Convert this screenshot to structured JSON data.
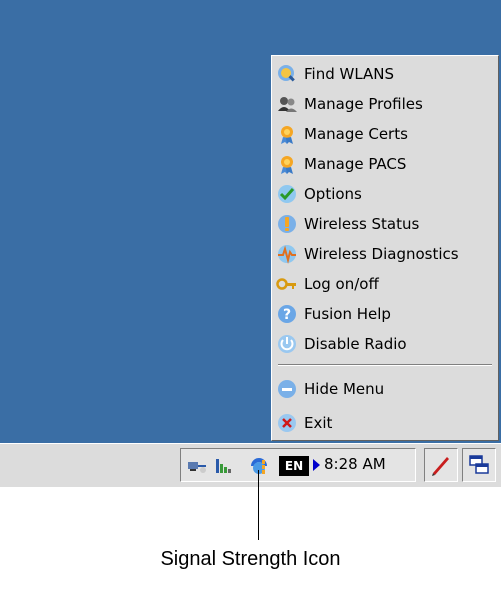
{
  "menu": {
    "items": [
      {
        "label": "Find WLANS",
        "icon": "find-wlans-icon"
      },
      {
        "label": "Manage Profiles",
        "icon": "manage-profiles-icon"
      },
      {
        "label": "Manage Certs",
        "icon": "manage-certs-icon"
      },
      {
        "label": "Manage PACS",
        "icon": "manage-pacs-icon"
      },
      {
        "label": "Options",
        "icon": "options-checkmark-icon"
      },
      {
        "label": "Wireless Status",
        "icon": "wireless-status-icon"
      },
      {
        "label": "Wireless Diagnostics",
        "icon": "wireless-diagnostics-icon"
      },
      {
        "label": "Log on/off",
        "icon": "key-icon"
      },
      {
        "label": "Fusion Help",
        "icon": "help-icon"
      },
      {
        "label": "Disable Radio",
        "icon": "power-icon"
      },
      {
        "label": "Hide Menu",
        "icon": "hide-menu-icon"
      },
      {
        "label": "Exit",
        "icon": "exit-icon"
      }
    ]
  },
  "taskbar": {
    "language": "EN",
    "clock": "8:28 AM"
  },
  "callout": {
    "label": "Signal Strength Icon"
  },
  "colors": {
    "desktop": "#3a6ea5",
    "menu_bg": "#dcdcdc",
    "taskbar_bg": "#dcdcdc"
  }
}
